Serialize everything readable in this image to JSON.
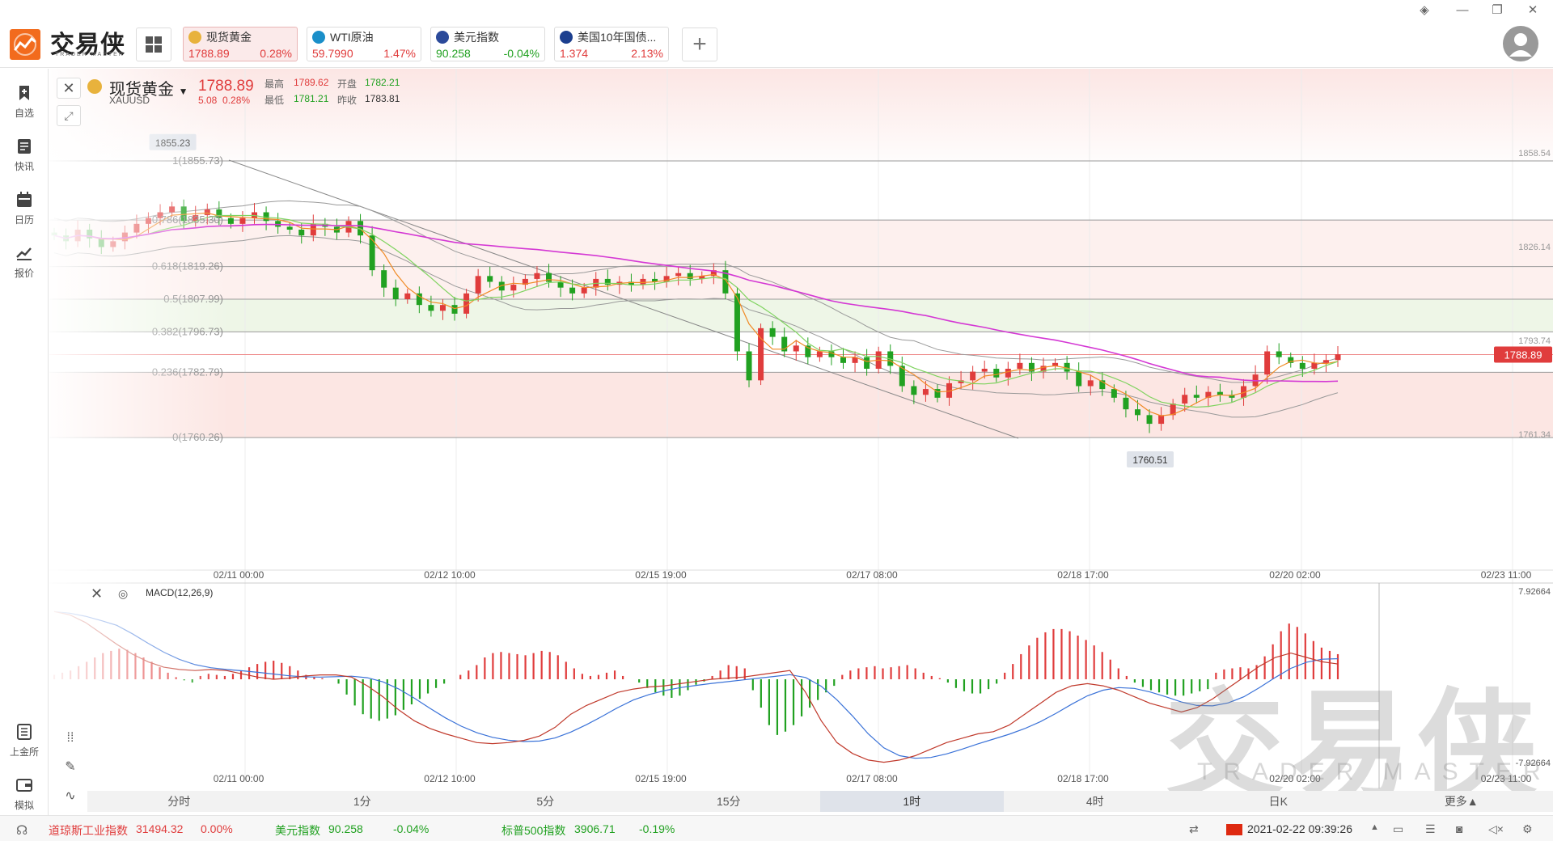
{
  "app": {
    "brand": "交易侠",
    "brand_sub": "TRADER MASTER"
  },
  "quotes": [
    {
      "name": "现货黄金",
      "price": "1788.89",
      "change": "0.28%",
      "dir": "up",
      "icon": "gold-coin-icon",
      "icon_color": "#e8b23c",
      "active": true
    },
    {
      "name": "WTI原油",
      "price": "59.7990",
      "change": "1.47%",
      "dir": "up",
      "icon": "oil-barrel-icon",
      "icon_color": "#1a8fc9",
      "active": false
    },
    {
      "name": "美元指数",
      "price": "90.258",
      "change": "-0.04%",
      "dir": "down",
      "icon": "us-flag-icon",
      "icon_color": "#2b4a9a",
      "active": false
    },
    {
      "name": "美国10年国债...",
      "price": "1.374",
      "change": "2.13%",
      "dir": "up",
      "icon": "bond-chart-icon",
      "icon_color": "#1c3f8f",
      "active": false
    }
  ],
  "sidebar": [
    {
      "label": "自选",
      "icon": "bookmark-icon"
    },
    {
      "label": "快讯",
      "icon": "news-icon"
    },
    {
      "label": "日历",
      "icon": "calendar-icon"
    },
    {
      "label": "报价",
      "icon": "quote-chart-icon"
    },
    {
      "label": "上金所",
      "icon": "exchange-icon"
    },
    {
      "label": "模拟",
      "icon": "wallet-icon"
    }
  ],
  "symbol": {
    "name": "现货黄金",
    "code": "XAUUSD",
    "price": "1788.89",
    "change": "5.08",
    "change_pct": "0.28%",
    "high_label": "最高",
    "high": "1789.62",
    "low_label": "最低",
    "low": "1781.21",
    "open_label": "开盘",
    "open": "1782.21",
    "prev_label": "昨收",
    "prev": "1783.81"
  },
  "chart_data": {
    "type": "candlestick",
    "y_axis_ticks": [
      "1858.54",
      "1826.14",
      "1793.74",
      "1761.34"
    ],
    "current_price": "1788.89",
    "high_marker": "1855.23",
    "low_marker": "1760.51",
    "fibonacci": [
      {
        "label": "1(1855.73)",
        "value": 1855.73
      },
      {
        "label": "0.786(1835.30)",
        "value": 1835.3
      },
      {
        "label": "0.618(1819.26)",
        "value": 1819.26
      },
      {
        "label": "0.5(1807.99)",
        "value": 1807.99
      },
      {
        "label": "0.382(1796.73)",
        "value": 1796.73
      },
      {
        "label": "0.236(1782.79)",
        "value": 1782.79
      },
      {
        "label": "0(1760.26)",
        "value": 1760.26
      }
    ],
    "x_axis_ticks": [
      "02/11 00:00",
      "02/12 10:00",
      "02/15 19:00",
      "02/17 08:00",
      "02/18 17:00",
      "02/20 02:00",
      "02/23 11:00"
    ],
    "ylim": [
      1748,
      1868
    ],
    "close_series": [
      1830,
      1828,
      1832,
      1829,
      1826,
      1828,
      1831,
      1834,
      1836,
      1838,
      1840,
      1835,
      1837,
      1839,
      1836,
      1834,
      1836,
      1838,
      1835,
      1833,
      1832,
      1830,
      1834,
      1833,
      1831,
      1835,
      1830,
      1818,
      1812,
      1808,
      1810,
      1806,
      1804,
      1806,
      1803,
      1810,
      1816,
      1814,
      1811,
      1813,
      1815,
      1817,
      1814,
      1812,
      1810,
      1812,
      1815,
      1813,
      1814,
      1813,
      1815,
      1814,
      1816,
      1817,
      1815,
      1816,
      1818,
      1810,
      1790,
      1780,
      1798,
      1795,
      1790,
      1792,
      1788,
      1790,
      1788,
      1786,
      1788,
      1784,
      1790,
      1785,
      1778,
      1775,
      1777,
      1774,
      1779,
      1780,
      1783,
      1784,
      1781,
      1784,
      1786,
      1783,
      1785,
      1786,
      1783,
      1778,
      1780,
      1777,
      1774,
      1770,
      1768,
      1765,
      1768,
      1772,
      1775,
      1774,
      1776,
      1775,
      1774,
      1778,
      1782,
      1790,
      1788,
      1786,
      1784,
      1786,
      1787,
      1789
    ]
  },
  "macd": {
    "label": "MACD(12,26,9)",
    "axis_top": "7.92664",
    "axis_bottom": "-7.92664",
    "histogram": [
      0.4,
      0.6,
      0.8,
      1.2,
      1.6,
      2,
      2.4,
      2.6,
      2.8,
      2.7,
      2.4,
      2,
      1.6,
      1.1,
      0.6,
      0.2,
      -0.1,
      -0.3,
      0.3,
      0.5,
      0.4,
      0.3,
      0.5,
      0.8,
      1.1,
      1.4,
      1.6,
      1.7,
      1.5,
      1.2,
      0.8,
      0.4,
      0.2,
      0.1,
      0,
      -0.4,
      -1.4,
      -2.4,
      -3.2,
      -3.6,
      -3.8,
      -3.6,
      -3.3,
      -2.8,
      -2.3,
      -1.8,
      -1.3,
      -0.8,
      -0.4,
      0,
      0.4,
      0.8,
      1.3,
      2,
      2.4,
      2.5,
      2.4,
      2.3,
      2.2,
      2.4,
      2.6,
      2.5,
      2.2,
      1.6,
      1,
      0.5,
      0.3,
      0.4,
      0.6,
      0.8,
      0.3,
      0,
      -0.3,
      -0.8,
      -1.2,
      -1.5,
      -1.7,
      -1.5,
      -1,
      -0.5,
      -0.2,
      0.3,
      0.8,
      1.3,
      1.2,
      1.0,
      -1.0,
      -2.6,
      -4.2,
      -5.1,
      -4.8,
      -4.2,
      -3.4,
      -2.6,
      -1.9,
      -1.2,
      -0.6,
      0.4,
      0.8,
      1.0,
      1.1,
      1.2,
      1.0,
      1.1,
      1.2,
      1.3,
      1.0,
      0.6,
      0.3,
      0.1,
      -0.3,
      -0.8,
      -1.1,
      -1.3,
      -1.3,
      -0.9,
      -0.4,
      0.6,
      1.4,
      2.3,
      3.1,
      3.8,
      4.3,
      4.6,
      4.6,
      4.4,
      4.0,
      3.6,
      3.1,
      2.5,
      1.8,
      1.0,
      0.3,
      -0.3,
      -0.7,
      -1.0,
      -1.2,
      -1.4,
      -1.5,
      -1.5,
      -1.3,
      -1.1,
      -0.9,
      0.6,
      0.9,
      1.0,
      1.1,
      1.0,
      1.3,
      2.1,
      3.2,
      4.4,
      5.1,
      4.8,
      4.2,
      3.5,
      2.9,
      2.6,
      2.3
    ],
    "dif": [
      6.2,
      5.9,
      5.2,
      4.2,
      3.2,
      2.3,
      1.6,
      1.1,
      0.9,
      0.8,
      0.9,
      0.8,
      0.5,
      0.2,
      0,
      0.1,
      0.3,
      0.4,
      0.4,
      0.2,
      -0.6,
      -1.6,
      -2.8,
      -3.8,
      -4.5,
      -5,
      -5.4,
      -5.8,
      -5.9,
      -5.8,
      -5.6,
      -5.2,
      -4.4,
      -3.2,
      -2.4,
      -1.8,
      -1.2,
      -0.9,
      -0.7,
      -0.6,
      -0.4,
      -0.2,
      0,
      0.1,
      0.2,
      0.4,
      0.6,
      0.8,
      -1.2,
      -3.8,
      -5.8,
      -6.8,
      -7.4,
      -7.6,
      -7.4,
      -7.0,
      -6.4,
      -5.8,
      -5.4,
      -5.0,
      -4.8,
      -4.2,
      -3.2,
      -2.2,
      -1.2,
      -0.6,
      -0.4,
      -0.6,
      -1.0,
      -1.6,
      -2.2,
      -2.6,
      -3.0,
      -2.6,
      -1.8,
      -0.8,
      0.2,
      1.2,
      2.0,
      2.4,
      2.0,
      1.6,
      1.4
    ]
  },
  "periods": [
    "分时",
    "1分",
    "5分",
    "15分",
    "1时",
    "4时",
    "日K",
    "更多▲"
  ],
  "active_period": "1时",
  "footer": {
    "indices": [
      {
        "name": "道琼斯工业指数",
        "value": "31494.32",
        "change": "0.00%",
        "dir": "up"
      },
      {
        "name": "美元指数",
        "value": "90.258",
        "change": "-0.04%",
        "dir": "down"
      },
      {
        "name": "标普500指数",
        "value": "3906.71",
        "change": "-0.19%",
        "dir": "down"
      }
    ],
    "datetime": "2021-02-22 09:39:26"
  },
  "watermark": {
    "main": "交易侠",
    "sub": "TRADER MASTER"
  },
  "colors": {
    "up": "#e03c3c",
    "down": "#21a121",
    "ma_long": "#d438d4",
    "accent": "#f26b1d"
  }
}
